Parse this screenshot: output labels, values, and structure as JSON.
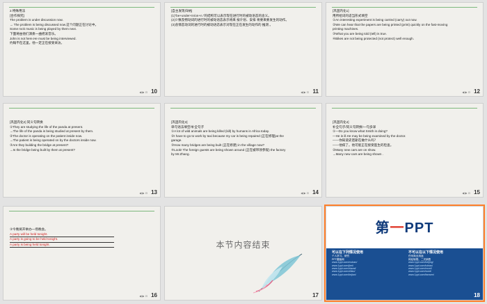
{
  "slides": [
    {
      "num": "10",
      "lines": [
        {
          "t": "2.特殊用法"
        },
        {
          "t": "[合作探究]"
        },
        {
          "t": "The problem is under discussion now."
        },
        {
          "t": "→ The problem is being discussed now.这个问题正在讨论中。"
        },
        {
          "t": "Some rock music is being played by them next."
        },
        {
          "t": "下面将由他们演奏一曲摇滚音乐。"
        },
        {
          "t": "John is not here.He must be being interviewed."
        },
        {
          "t": "约翰不在这里。他一定正在接受采访。"
        }
      ]
    },
    {
      "num": "11",
      "lines": [
        {
          "t": "[自主发现归纳]"
        },
        {
          "t": "(1)“be+under+in/on+n.”的结构可以表示现在进行时的被动语态的含义。",
          "a": "be+under+in/on+n."
        },
        {
          "t": "(2)少数及物动词的进行时的被动语态表示将来 按计划、安排 将要来要发生的动作。",
          "a": "按计划、安排"
        },
        {
          "t": "(3)含情态动词的进行时的被动语态表示对现在正在发生的动作的 推测 。",
          "a": "推测"
        }
      ]
    },
    {
      "num": "12",
      "lines": [
        {
          "t": "[巩固内化1]"
        },
        {
          "t": "用所给词的适当形式填空"
        },
        {
          "t": "①An interesting experiment  is being carried  (carry) out now."
        },
        {
          "t": "②We can hear that the papers  are being printed  (print) quickly on the fast-moving"
        },
        {
          "t": "printing machines."
        },
        {
          "t": "③What you  are being told  (tell) is true."
        },
        {
          "t": "④Bikes  are not being protected  (not protect) well enough."
        }
      ]
    },
    {
      "num": "13",
      "lines": [
        {
          "t": "[巩固内化2]  同义句转换"
        },
        {
          "t": "①They are studying the life of the panda at present."
        },
        {
          "t": "→The life of the panda  is being studied  at present by them."
        },
        {
          "t": "②The doctor is operating on the patient inside now."
        },
        {
          "t": "→The patient  is being operated on  by the doctors inside now."
        },
        {
          "t": "③Are they building the bridge at present?"
        },
        {
          "t": "→Is the bridge  being built  by them at present?"
        }
      ]
    },
    {
      "num": "14",
      "lines": [
        {
          "t": "[巩固内化3]"
        },
        {
          "t": "单句语法填空/补全句子"
        },
        {
          "t": "①A lot of wild animals  are being killed  (kill) by humans in Africa today."
        },
        {
          "t": "②I have to go to work by taxi because my car  is being repaired  (正在修理)at the"
        },
        {
          "t": "garage."
        },
        {
          "t": "③How many bridges  are being built  (正在修建) in the village now?"
        },
        {
          "t": "④Look! The foreign guests  are being shown around  (正在被带领参观) the factory"
        },
        {
          "t": "by Mr.Zhang."
        }
      ]
    },
    {
      "num": "15",
      "lines": [
        {
          "t": "[巩固内化4]"
        },
        {
          "t": "补全句子/同义句转换/一句多译"
        },
        {
          "t": "①—Do you know what Smith is doing?"
        },
        {
          "t": "—He is ill.He  may be being examined  by the doctor."
        },
        {
          "t": "——你知道史密斯在做什么吗？"
        },
        {
          "t": "——他病了。他可能正在接受医生的检查。"
        },
        {
          "t": "②Many new cars are on show."
        },
        {
          "t": "→Many new cars  are being shown  ."
        }
      ]
    },
    {
      "num": "16",
      "lines": [
        {
          "t": "③今晚将开举办一场晚会。"
        },
        {
          "t": "A party will be held tonight.",
          "red": true
        },
        {
          "t": "A party is going to be held tonight.",
          "red": true
        },
        {
          "t": "A party is being held tonight.",
          "red": true
        }
      ]
    },
    {
      "num": "17",
      "end": "本节内容结束"
    },
    {
      "num": "18",
      "ad": {
        "logo_a": "第",
        "logo_b": "一",
        "logo_c": "PPT",
        "left_title": "可以在下列情况使用",
        "left_items": [
          "个人学习、研究",
          "PPT模板网",
          "www.1ppt.com/moban/",
          "www.1ppt.com/jieri/",
          "www.1ppt.com/xiazai/",
          "www.1ppt.com/ziliao/",
          "www.1ppt.com/kejian/"
        ],
        "right_title": "不可以在以下情况使用",
        "right_items": [
          "任何商业用途",
          "网站转载、二次销售",
          "www.1ppt.com/beijing/",
          "www.1ppt.com/tubiao/",
          "www.1ppt.com/excel/",
          "www.1ppt.com/word/",
          "www.1ppt.com/fanwen/"
        ]
      }
    }
  ],
  "nav": "◀ ▶ ⊡"
}
